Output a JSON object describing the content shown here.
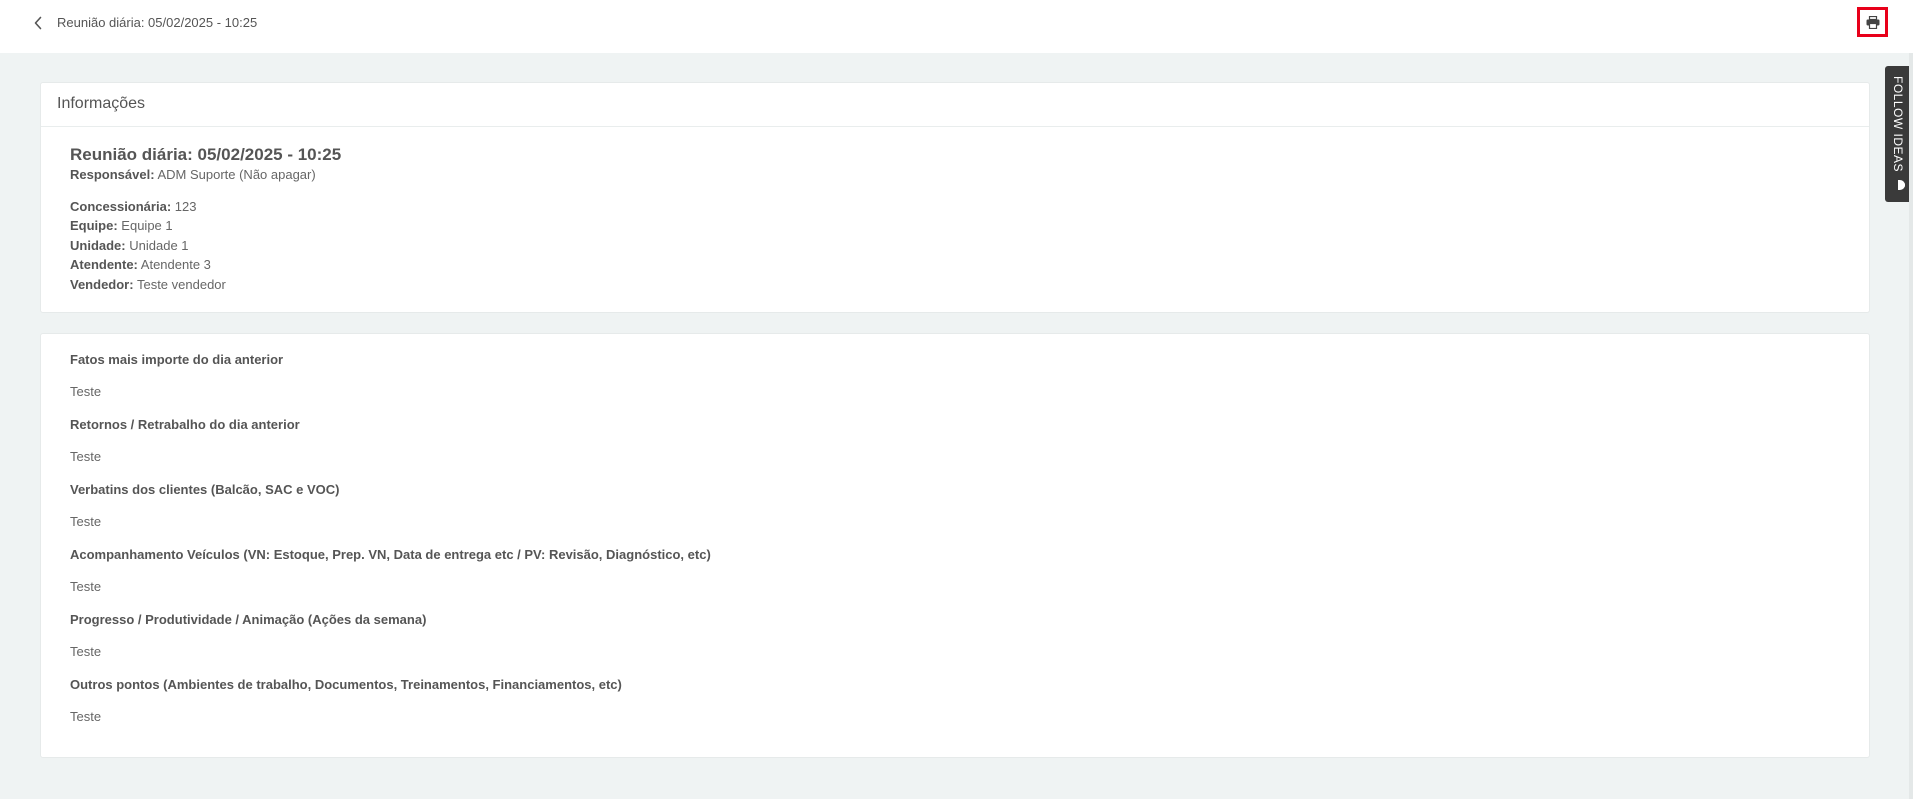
{
  "topbar": {
    "title": "Reunião diária: 05/02/2025 - 10:25",
    "back_icon": "chevron-left-icon",
    "print_icon": "printer-icon"
  },
  "info_card": {
    "header": "Informações",
    "title": "Reunião diária: 05/02/2025 - 10:25",
    "fields": [
      {
        "label": "Responsável:",
        "value": "ADM Suporte (Não apagar)"
      },
      {
        "label": "Concessionária:",
        "value": "123"
      },
      {
        "label": "Equipe:",
        "value": "Equipe 1"
      },
      {
        "label": "Unidade:",
        "value": "Unidade 1"
      },
      {
        "label": "Atendente:",
        "value": "Atendente 3"
      },
      {
        "label": "Vendedor:",
        "value": "Teste vendedor"
      }
    ]
  },
  "details": [
    {
      "label": "Fatos mais importe do dia anterior",
      "answer": "Teste"
    },
    {
      "label": "Retornos / Retrabalho do dia anterior",
      "answer": "Teste"
    },
    {
      "label": "Verbatins dos clientes (Balcão, SAC e VOC)",
      "answer": "Teste"
    },
    {
      "label": "Acompanhamento Veículos (VN: Estoque, Prep. VN, Data de entrega etc / PV: Revisão, Diagnóstico, etc)",
      "answer": "Teste"
    },
    {
      "label": "Progresso / Produtividade / Animação (Ações da semana)",
      "answer": "Teste"
    },
    {
      "label": "Outros pontos (Ambientes de trabalho, Documentos, Treinamentos, Financiamentos, etc)",
      "answer": "Teste"
    }
  ],
  "follow_tab": {
    "label": "FOLLOW IDEAS",
    "icon": "lightbulb-icon"
  },
  "colors": {
    "background": "#eff3f3",
    "print_highlight": "#e8001a",
    "follow_tab": "#3a3a3a"
  }
}
